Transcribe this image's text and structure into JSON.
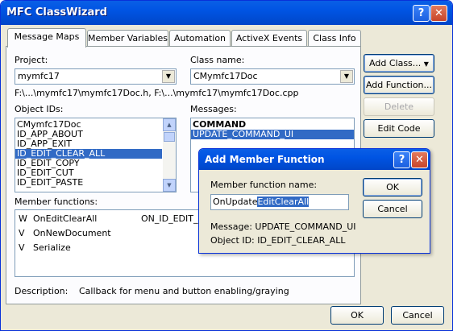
{
  "window": {
    "title": "MFC ClassWizard",
    "help_glyph": "?",
    "close_glyph": "✕"
  },
  "tabs": [
    "Message Maps",
    "Member Variables",
    "Automation",
    "ActiveX Events",
    "Class Info"
  ],
  "project": {
    "label": "Project:",
    "value": "mymfc17"
  },
  "class_name": {
    "label": "Class name:",
    "value": "CMymfc17Doc"
  },
  "path_text": "F:\\...\\mymfc17\\mymfc17Doc.h, F:\\...\\mymfc17\\mymfc17Doc.cpp",
  "object_ids": {
    "label": "Object IDs:",
    "items": [
      "CMymfc17Doc",
      "ID_APP_ABOUT",
      "ID_APP_EXIT",
      "ID_EDIT_CLEAR_ALL",
      "ID_EDIT_COPY",
      "ID_EDIT_CUT",
      "ID_EDIT_PASTE"
    ],
    "selected_index": 3
  },
  "messages": {
    "label": "Messages:",
    "items": [
      "COMMAND",
      "UPDATE_COMMAND_UI"
    ],
    "selected_index": 1
  },
  "member_functions": {
    "label": "Member functions:",
    "rows": [
      {
        "flag": "W",
        "name": "OnEditClearAll",
        "id": "ON_ID_EDIT_C"
      },
      {
        "flag": "V",
        "name": "OnNewDocument",
        "id": ""
      },
      {
        "flag": "V",
        "name": "Serialize",
        "id": ""
      }
    ]
  },
  "description": {
    "label": "Description:",
    "text": "Callback for menu and button enabling/graying"
  },
  "side_buttons": {
    "add_class": "Add Class...",
    "add_function": "Add Function...",
    "delete_function": "Delete Function",
    "edit_code": "Edit Code"
  },
  "bottom_buttons": {
    "ok": "OK",
    "cancel": "Cancel"
  },
  "dialog": {
    "title": "Add Member Function",
    "help_glyph": "?",
    "close_glyph": "✕",
    "field_label": "Member function name:",
    "input_prefix": "OnUpdate",
    "input_selected": "EditClearAll",
    "message_line": "Message: UPDATE_COMMAND_UI",
    "object_line": "Object ID: ID_EDIT_CLEAR_ALL",
    "ok": "OK",
    "cancel": "Cancel"
  }
}
